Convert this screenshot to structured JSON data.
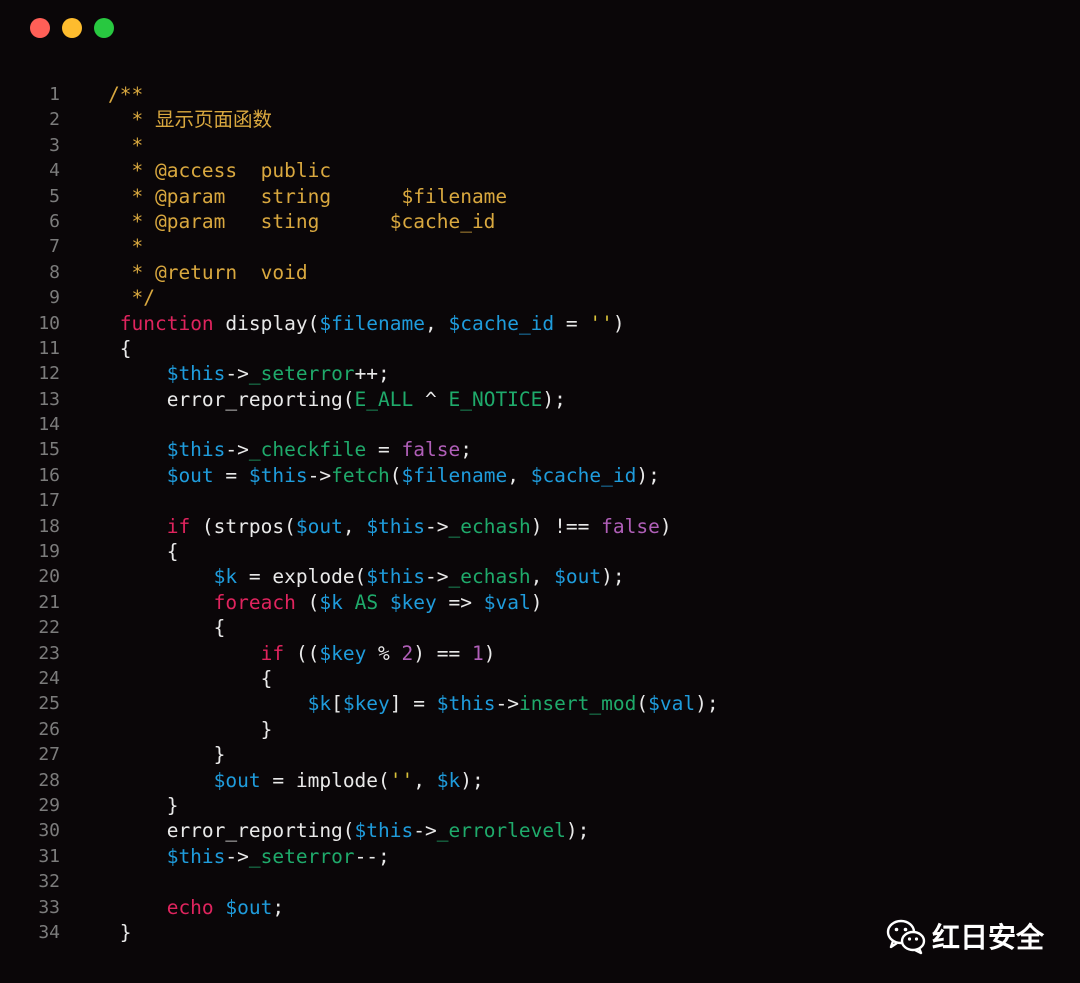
{
  "window": {
    "controls": [
      {
        "name": "close-dot",
        "color": "#ff5f57"
      },
      {
        "name": "minimize-dot",
        "color": "#febc2e"
      },
      {
        "name": "zoom-dot",
        "color": "#28c840"
      }
    ]
  },
  "colors": {
    "comment": "#d9a83f",
    "keyword": "#e0245e",
    "variable": "#1f9cdc",
    "property": "#1faa6b",
    "literal": "#b05fb8",
    "string": "#d9c23a",
    "plain": "#e9e9e9",
    "line_number": "#7c7c7c"
  },
  "code_lines": [
    {
      "n": "1",
      "tokens": [
        [
          "c",
          "/**"
        ]
      ]
    },
    {
      "n": "2",
      "tokens": [
        [
          "c",
          "  * 显示页面函数"
        ]
      ]
    },
    {
      "n": "3",
      "tokens": [
        [
          "c",
          "  *"
        ]
      ]
    },
    {
      "n": "4",
      "tokens": [
        [
          "c",
          "  * @access  public"
        ]
      ]
    },
    {
      "n": "5",
      "tokens": [
        [
          "c",
          "  * @param   string      $filename"
        ]
      ]
    },
    {
      "n": "6",
      "tokens": [
        [
          "c",
          "  * @param   sting      $cache_id"
        ]
      ]
    },
    {
      "n": "7",
      "tokens": [
        [
          "c",
          "  *"
        ]
      ]
    },
    {
      "n": "8",
      "tokens": [
        [
          "c",
          "  * @return  void"
        ]
      ]
    },
    {
      "n": "9",
      "tokens": [
        [
          "c",
          "  */"
        ]
      ]
    },
    {
      "n": "10",
      "tokens": [
        [
          "p",
          " "
        ],
        [
          "k",
          "function"
        ],
        [
          "p",
          " display("
        ],
        [
          "v",
          "$filename"
        ],
        [
          "p",
          ", "
        ],
        [
          "v",
          "$cache_id"
        ],
        [
          "p",
          " = "
        ],
        [
          "s",
          "''"
        ],
        [
          "p",
          ")"
        ]
      ]
    },
    {
      "n": "11",
      "tokens": [
        [
          "p",
          " {"
        ]
      ]
    },
    {
      "n": "12",
      "tokens": [
        [
          "p",
          "     "
        ],
        [
          "v",
          "$this"
        ],
        [
          "p",
          "->"
        ],
        [
          "m",
          "_seterror"
        ],
        [
          "p",
          "++;"
        ]
      ]
    },
    {
      "n": "13",
      "tokens": [
        [
          "p",
          "     error_reporting("
        ],
        [
          "m",
          "E_ALL"
        ],
        [
          "p",
          " ^ "
        ],
        [
          "m",
          "E_NOTICE"
        ],
        [
          "p",
          ");"
        ]
      ]
    },
    {
      "n": "14",
      "tokens": []
    },
    {
      "n": "15",
      "tokens": [
        [
          "p",
          "     "
        ],
        [
          "v",
          "$this"
        ],
        [
          "p",
          "->"
        ],
        [
          "m",
          "_checkfile"
        ],
        [
          "p",
          " = "
        ],
        [
          "l",
          "false"
        ],
        [
          "p",
          ";"
        ]
      ]
    },
    {
      "n": "16",
      "tokens": [
        [
          "p",
          "     "
        ],
        [
          "v",
          "$out"
        ],
        [
          "p",
          " = "
        ],
        [
          "v",
          "$this"
        ],
        [
          "p",
          "->"
        ],
        [
          "m",
          "fetch"
        ],
        [
          "p",
          "("
        ],
        [
          "v",
          "$filename"
        ],
        [
          "p",
          ", "
        ],
        [
          "v",
          "$cache_id"
        ],
        [
          "p",
          ");"
        ]
      ]
    },
    {
      "n": "17",
      "tokens": []
    },
    {
      "n": "18",
      "tokens": [
        [
          "p",
          "     "
        ],
        [
          "k",
          "if"
        ],
        [
          "p",
          " (strpos("
        ],
        [
          "v",
          "$out"
        ],
        [
          "p",
          ", "
        ],
        [
          "v",
          "$this"
        ],
        [
          "p",
          "->"
        ],
        [
          "m",
          "_echash"
        ],
        [
          "p",
          ") !== "
        ],
        [
          "l",
          "false"
        ],
        [
          "p",
          ")"
        ]
      ]
    },
    {
      "n": "19",
      "tokens": [
        [
          "p",
          "     {"
        ]
      ]
    },
    {
      "n": "20",
      "tokens": [
        [
          "p",
          "         "
        ],
        [
          "v",
          "$k"
        ],
        [
          "p",
          " = explode("
        ],
        [
          "v",
          "$this"
        ],
        [
          "p",
          "->"
        ],
        [
          "m",
          "_echash"
        ],
        [
          "p",
          ", "
        ],
        [
          "v",
          "$out"
        ],
        [
          "p",
          ");"
        ]
      ]
    },
    {
      "n": "21",
      "tokens": [
        [
          "p",
          "         "
        ],
        [
          "k",
          "foreach"
        ],
        [
          "p",
          " ("
        ],
        [
          "v",
          "$k"
        ],
        [
          "p",
          " "
        ],
        [
          "m",
          "AS"
        ],
        [
          "p",
          " "
        ],
        [
          "v",
          "$key"
        ],
        [
          "p",
          " => "
        ],
        [
          "v",
          "$val"
        ],
        [
          "p",
          ")"
        ]
      ]
    },
    {
      "n": "22",
      "tokens": [
        [
          "p",
          "         {"
        ]
      ]
    },
    {
      "n": "23",
      "tokens": [
        [
          "p",
          "             "
        ],
        [
          "k",
          "if"
        ],
        [
          "p",
          " (("
        ],
        [
          "v",
          "$key"
        ],
        [
          "p",
          " % "
        ],
        [
          "l",
          "2"
        ],
        [
          "p",
          ") == "
        ],
        [
          "l",
          "1"
        ],
        [
          "p",
          ")"
        ]
      ]
    },
    {
      "n": "24",
      "tokens": [
        [
          "p",
          "             {"
        ]
      ]
    },
    {
      "n": "25",
      "tokens": [
        [
          "p",
          "                 "
        ],
        [
          "v",
          "$k"
        ],
        [
          "p",
          "["
        ],
        [
          "v",
          "$key"
        ],
        [
          "p",
          "] = "
        ],
        [
          "v",
          "$this"
        ],
        [
          "p",
          "->"
        ],
        [
          "m",
          "insert_mod"
        ],
        [
          "p",
          "("
        ],
        [
          "v",
          "$val"
        ],
        [
          "p",
          ");"
        ]
      ]
    },
    {
      "n": "26",
      "tokens": [
        [
          "p",
          "             }"
        ]
      ]
    },
    {
      "n": "27",
      "tokens": [
        [
          "p",
          "         }"
        ]
      ]
    },
    {
      "n": "28",
      "tokens": [
        [
          "p",
          "         "
        ],
        [
          "v",
          "$out"
        ],
        [
          "p",
          " = implode("
        ],
        [
          "s",
          "''"
        ],
        [
          "p",
          ", "
        ],
        [
          "v",
          "$k"
        ],
        [
          "p",
          ");"
        ]
      ]
    },
    {
      "n": "29",
      "tokens": [
        [
          "p",
          "     }"
        ]
      ]
    },
    {
      "n": "30",
      "tokens": [
        [
          "p",
          "     error_reporting("
        ],
        [
          "v",
          "$this"
        ],
        [
          "p",
          "->"
        ],
        [
          "m",
          "_errorlevel"
        ],
        [
          "p",
          ");"
        ]
      ]
    },
    {
      "n": "31",
      "tokens": [
        [
          "p",
          "     "
        ],
        [
          "v",
          "$this"
        ],
        [
          "p",
          "->"
        ],
        [
          "m",
          "_seterror"
        ],
        [
          "p",
          "--;"
        ]
      ]
    },
    {
      "n": "32",
      "tokens": []
    },
    {
      "n": "33",
      "tokens": [
        [
          "p",
          "     "
        ],
        [
          "k",
          "echo"
        ],
        [
          "p",
          " "
        ],
        [
          "v",
          "$out"
        ],
        [
          "p",
          ";"
        ]
      ]
    },
    {
      "n": "34",
      "tokens": [
        [
          "p",
          " }"
        ]
      ]
    }
  ],
  "watermark": {
    "icon": "wechat-icon",
    "text": "红日安全"
  }
}
